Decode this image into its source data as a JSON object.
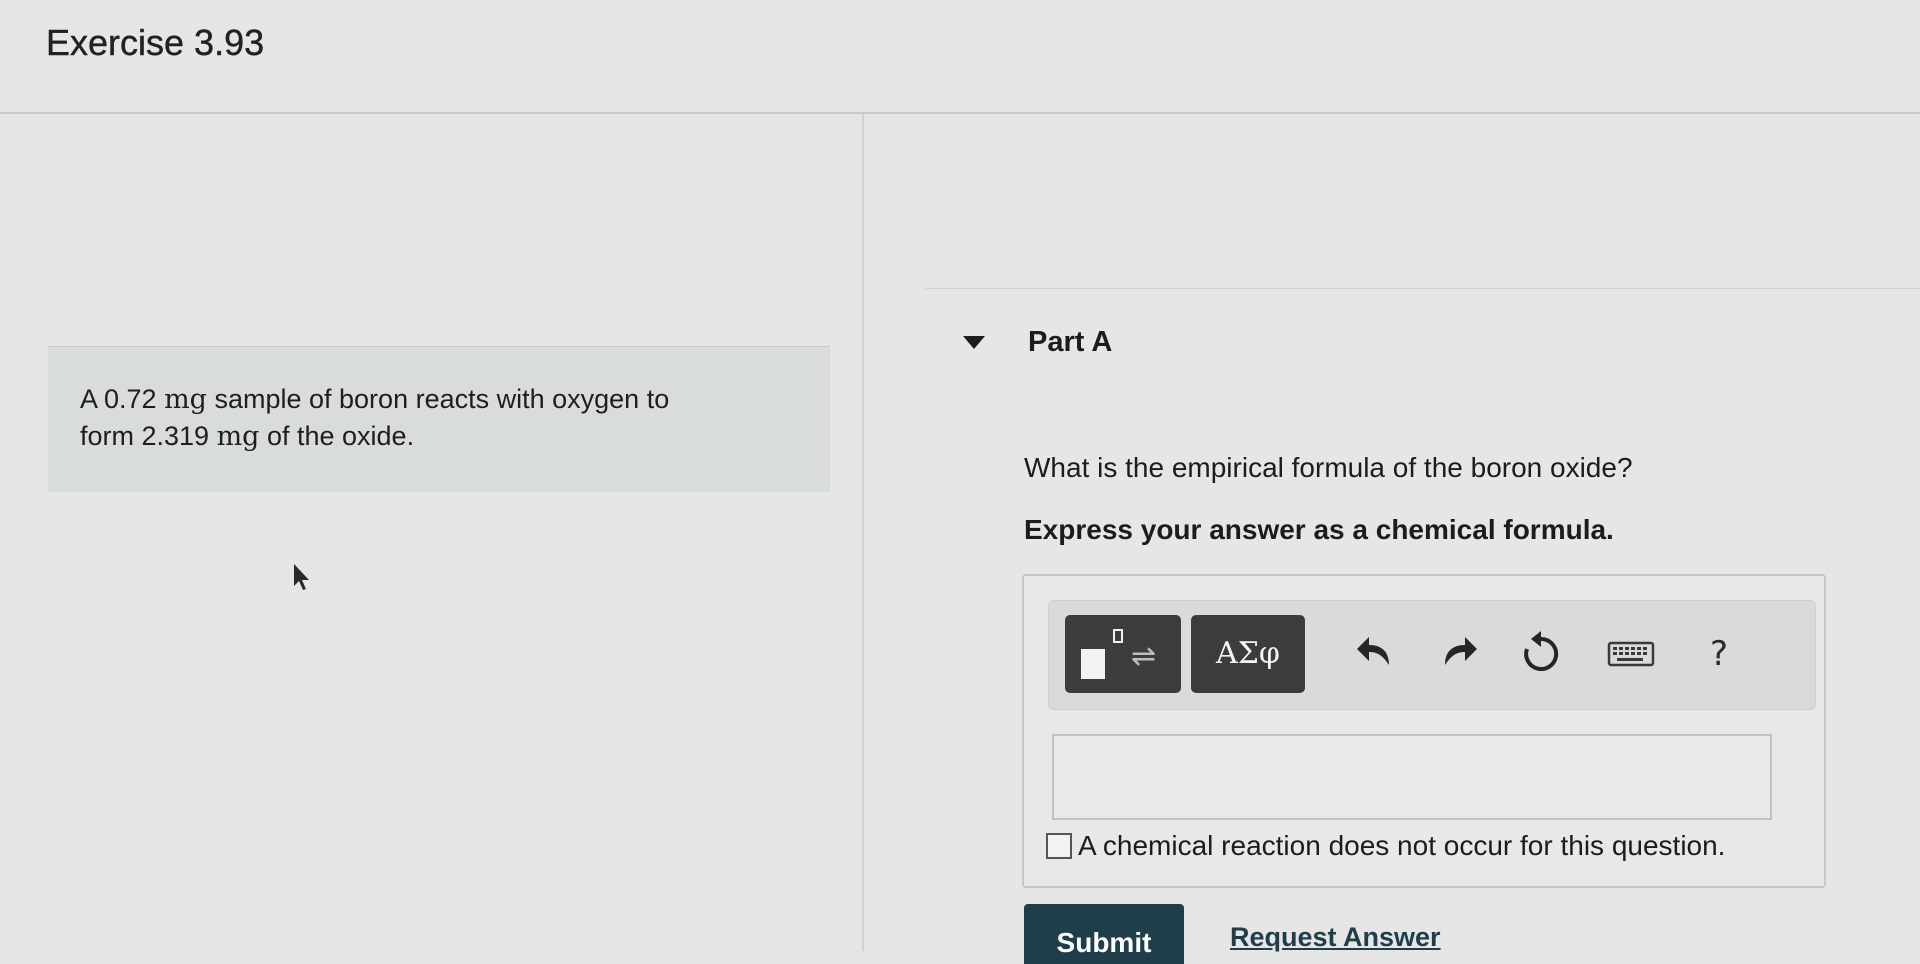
{
  "header": {
    "title": "Exercise 3.93"
  },
  "problem": {
    "line1_prefix": "A 0.72 ",
    "line1_unit": "mg",
    "line1_suffix": " sample of boron reacts with oxygen to",
    "line2_prefix": "form 2.319 ",
    "line2_unit": "mg",
    "line2_suffix": " of the oxide."
  },
  "part": {
    "title": "Part A",
    "question": "What is the empirical formula of the boron oxide?",
    "instruction": "Express your answer as a chemical formula."
  },
  "toolbar": {
    "greek_label": "ΑΣφ",
    "template_arrows": "⇌",
    "help_label": "?",
    "icons": [
      "templates-icon",
      "greek-letters-icon",
      "undo-icon",
      "redo-icon",
      "reset-icon",
      "keyboard-icon",
      "help-icon"
    ]
  },
  "answer": {
    "value": "",
    "no_reaction_label": "A chemical reaction does not occur for this question.",
    "no_reaction_checked": false
  },
  "actions": {
    "submit_label": "Submit",
    "request_answer_label": "Request Answer"
  },
  "colors": {
    "submit_bg": "#1f3e4c",
    "toolbar_button_bg": "#3c3c3c",
    "page_bg": "#e6e6e4"
  }
}
